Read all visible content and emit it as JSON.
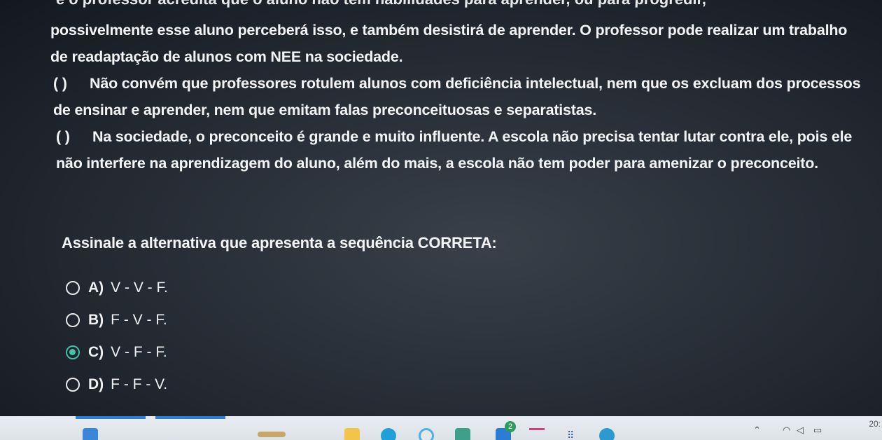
{
  "text": {
    "partial_top": "e o professor acredita que o aluno não tem habilidades para aprender, ou para progredir,",
    "p1": "possivelmente esse aluno perceberá isso, e também desistirá de aprender. O professor pode realizar um trabalho de readaptação de alunos com NEE na sociedade.",
    "p2_paren": "(     )",
    "p2": "Não convém que professores rotulem alunos com deficiência intelectual, nem que os excluam dos processos de ensinar e aprender, nem que emitam falas preconceituosas e separatistas.",
    "p3_paren": "(     )",
    "p3": "Na sociedade, o preconceito é grande e muito influente. A escola não precisa tentar lutar contra ele, pois ele não interfere na aprendizagem do aluno, além do mais, a escola não tem poder para amenizar o preconceito.",
    "question": "Assinale a alternativa que apresenta a sequência CORRETA:"
  },
  "options": [
    {
      "letter": "A)",
      "text": "V - V - F.",
      "selected": false
    },
    {
      "letter": "B)",
      "text": "F - V - F.",
      "selected": false
    },
    {
      "letter": "C)",
      "text": "V - F - F.",
      "selected": true
    },
    {
      "letter": "D)",
      "text": "F - F - V.",
      "selected": false
    }
  ],
  "taskbar": {
    "badge": "2",
    "clock": "20:"
  },
  "colors": {
    "selected_radio": "#43c6ae",
    "taskbar_bg": "#e3e8ed"
  }
}
